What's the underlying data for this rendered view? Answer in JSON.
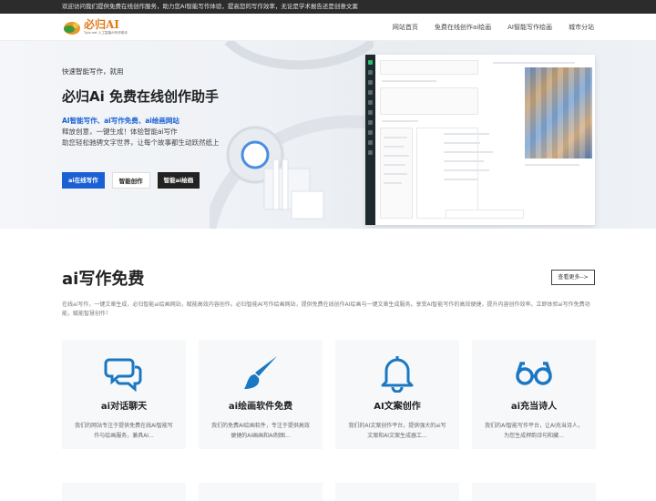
{
  "topbar": {
    "text": "欢迎访问我们提供免费在线创作服务，助力您AI智能写作体验，提高您的写作效率，无论是学术报告还是创意文案"
  },
  "logo": {
    "main": "必归AI",
    "sub": "Tpix.net 人工智能AI写作助手"
  },
  "nav": [
    {
      "label": "网站首页"
    },
    {
      "label": "免费在线创作ai绘画"
    },
    {
      "label": "AI智能写作绘画"
    },
    {
      "label": "城市分站"
    }
  ],
  "hero": {
    "kicker": "快速智能写作，就用",
    "title": "必归Ai 免费在线创作助手",
    "highlight": "AI智能写作、ai写作免费、ai绘画网站",
    "line1": "释放创意，一键生成！体验智能ai写作",
    "line2": "助您轻松驰骋文字世界，让每个故事都生动跃然纸上",
    "buttons": [
      {
        "label": "ai在线写作"
      },
      {
        "label": "智能创作"
      },
      {
        "label": "智能ai绘画"
      }
    ]
  },
  "section": {
    "title": "ai写作免费",
    "more": "查看更多-->",
    "desc": "在线ai写作，一键文章生成，必归智能ai绘画网站，赋能高效内容创作。必归智能AI写作绘画网站，提供免费在线创作AI绘画与一键文章生成服务。享受AI智能写作的高效便捷，提升内容创作效率。立即体验ai写作免费功能，赋能智慧创作！"
  },
  "cards": [
    {
      "title": "ai对话聊天",
      "desc": "我们的网站专注于提供免费在线AI智能写作与绘画服务，兼具AI...",
      "icon": "chat-bubbles-icon"
    },
    {
      "title": "ai绘画软件免费",
      "desc": "我们的免费AI绘画软件，专注于提供高效便捷的AI画画和AI制图...",
      "icon": "paint-brush-icon"
    },
    {
      "title": "AI文案创作",
      "desc": "我们的AI文案创作平台，提供强大的ai写文案和AI文案生成器工...",
      "icon": "bell-icon"
    },
    {
      "title": "ai充当诗人",
      "desc": "我们的AI智能写作平台，让AI充当诗人，为您生成押韵诗句和藏...",
      "icon": "glasses-icon"
    }
  ],
  "colors": {
    "accent": "#1a5fd4",
    "icon_blue": "#1a78c2",
    "dark": "#222222",
    "logo_orange": "#e07b1a"
  }
}
